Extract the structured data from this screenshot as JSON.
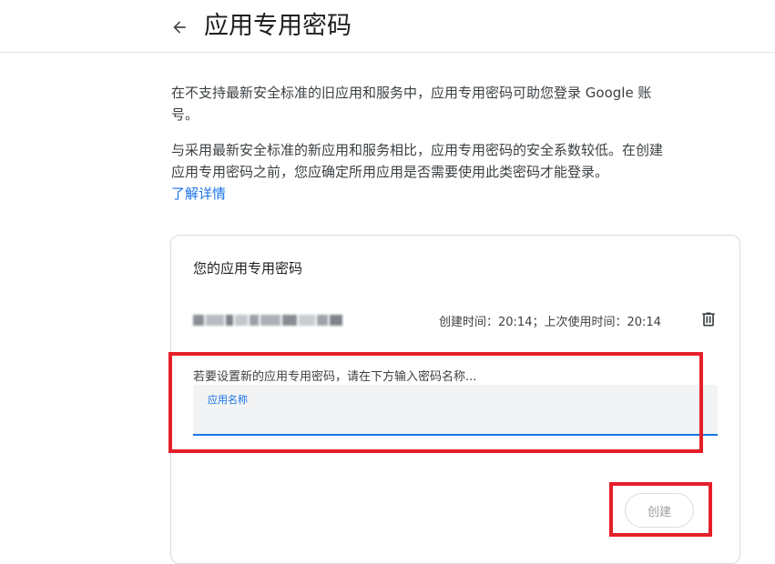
{
  "header": {
    "title": "应用专用密码",
    "back_icon": "arrow-back-icon"
  },
  "intro": {
    "paragraph1": "在不支持最新安全标准的旧应用和服务中，应用专用密码可助您登录 Google 账号。",
    "paragraph2": "与采用最新安全标准的新应用和服务相比，应用专用密码的安全系数较低。在创建应用专用密码之前，您应确定所用应用是否需要使用此类密码才能登录。",
    "learn_more": "了解详情"
  },
  "card": {
    "title": "您的应用专用密码",
    "passwords": [
      {
        "name_redacted": true,
        "meta": "创建时间：20:14；上次使用时间：20:14",
        "delete_icon": "trash-icon"
      }
    ],
    "new_prompt": "若要设置新的应用专用密码，请在下方输入密码名称...",
    "name_field": {
      "label": "应用名称",
      "value": ""
    },
    "create_label": "创建"
  },
  "colors": {
    "accent": "#1a73e8",
    "highlight": "#e51f2a",
    "disabled_text": "#a0a0a0",
    "field_bg": "#f1f3f4"
  }
}
